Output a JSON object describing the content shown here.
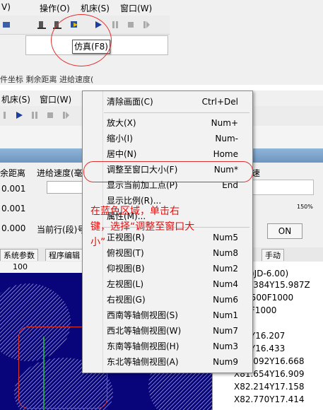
{
  "top": {
    "menu": [
      "V)",
      "操作(O)",
      "机床(S)",
      "窗口(W)"
    ],
    "tooltip": "仿真(F8)",
    "cut_labels": "件坐标      剩余距离      进给速度("
  },
  "main": {
    "menu": [
      "机床(S)",
      "窗口(W)"
    ],
    "labels": {
      "remaining": "余距离",
      "feed": "进给速度(毫",
      "v1": "0.001",
      "v2": "0.001",
      "v3": "0.000",
      "current_line": "当前行(段)号",
      "speed": "速",
      "pct": "150%",
      "on": "ON"
    },
    "tabs": [
      "系统参数",
      "程序编辑",
      "手动"
    ],
    "ruler": "100"
  },
  "context_menu": [
    {
      "label": "清除画面(C)",
      "shortcut": "Ctrl+Del"
    },
    {
      "label": "放大(X)",
      "shortcut": "Num+"
    },
    {
      "label": "缩小(I)",
      "shortcut": "Num-"
    },
    {
      "label": "居中(N)",
      "shortcut": "Home"
    },
    {
      "label": "调整至窗口大小(F)",
      "shortcut": "Num*"
    },
    {
      "label": "显示当前加工点(P)",
      "shortcut": "End"
    },
    {
      "label": "显示比例(R)...",
      "shortcut": ""
    },
    {
      "label": "属性(M)...",
      "shortcut": ""
    },
    {
      "label": "正视图(R)",
      "shortcut": "Num5"
    },
    {
      "label": "俯视图(T)",
      "shortcut": "Num8"
    },
    {
      "label": "仰视图(B)",
      "shortcut": "Num2"
    },
    {
      "label": "左视图(L)",
      "shortcut": "Num4"
    },
    {
      "label": "右视图(G)",
      "shortcut": "Num6"
    },
    {
      "label": "西南等轴侧视图(S)",
      "shortcut": "Num1"
    },
    {
      "label": "西北等轴侧视图(W)",
      "shortcut": "Num7"
    },
    {
      "label": "东南等轴侧视图(H)",
      "shortcut": "Num3"
    },
    {
      "label": "东北等轴侧视图(A)",
      "shortcut": "Num9"
    }
  ],
  "annotation": "在蓝色区域，单击右键，选择“调整至窗口大小”",
  "code_lines": [
    "平底)JD-6.00)",
    "X46.384Y15.987Z",
    "Z-2.500F1000",
    "385F1000",
    "987",
    "957Y16.207",
    "526Y16.433",
    "X81.092Y16.668",
    "X81.654Y16.909",
    "X82.214Y17.158",
    "X82.770Y17.414"
  ],
  "colors": {
    "canvas": "#08057a",
    "annotation": "#e01010",
    "highlight_border": "#e03030"
  }
}
